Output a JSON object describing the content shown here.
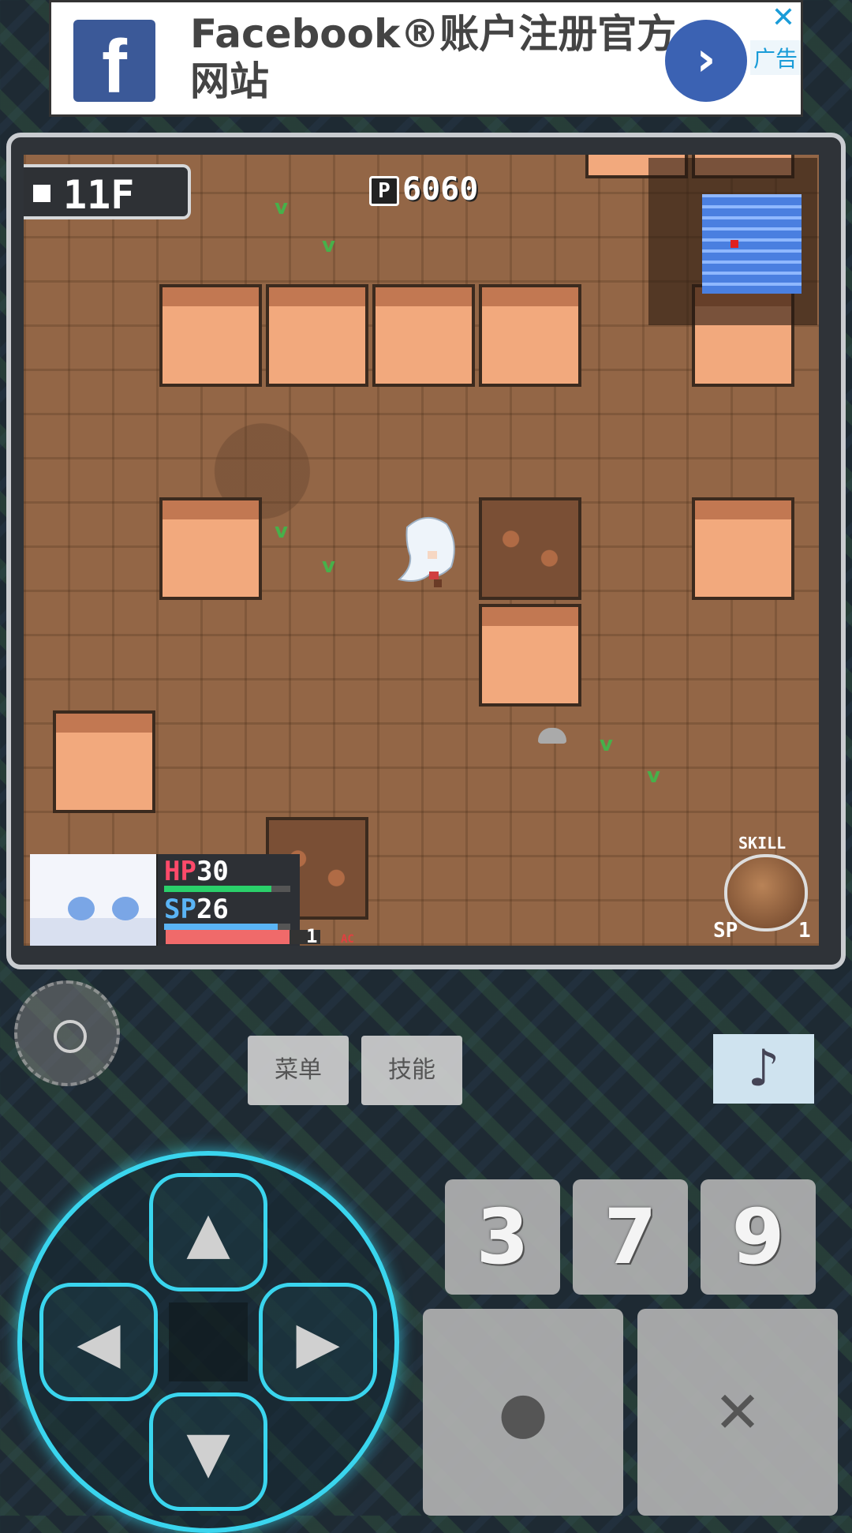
{
  "ad": {
    "logo_letter": "f",
    "text": "Facebook®账户注册官方网站",
    "arrow": "›",
    "close": "✕",
    "tag": "广告"
  },
  "hud": {
    "floor": "11F",
    "points_icon": "P",
    "points": "6060",
    "hp_label": "HP",
    "hp": "30",
    "sp_label": "SP",
    "sp": "26",
    "ac_value": "1",
    "ac_label": "AC",
    "hp_fill": 0.85,
    "sp_fill": 0.9,
    "ac_fill": 0.8
  },
  "skill": {
    "label": "SKILL",
    "sp_label": "SP",
    "sp_cost": "1"
  },
  "controls": {
    "menu_label": "菜单",
    "skill_label": "技能",
    "music_icon": "♪",
    "num_3": "3",
    "num_7": "7",
    "num_9": "9",
    "confirm_symbol": "●",
    "cancel_symbol": "✕",
    "dpad_up": "▲",
    "dpad_down": "▼",
    "dpad_left": "◀",
    "dpad_right": "▶"
  },
  "icons": {
    "ad_logo": "facebook-icon",
    "gear": "gear-icon",
    "music": "music-note-icon"
  },
  "colors": {
    "accent_dpad": "#3ad5ee",
    "hp": "#ff4a6a",
    "sp": "#5ab4f5",
    "ad_blue": "#3b5998"
  }
}
